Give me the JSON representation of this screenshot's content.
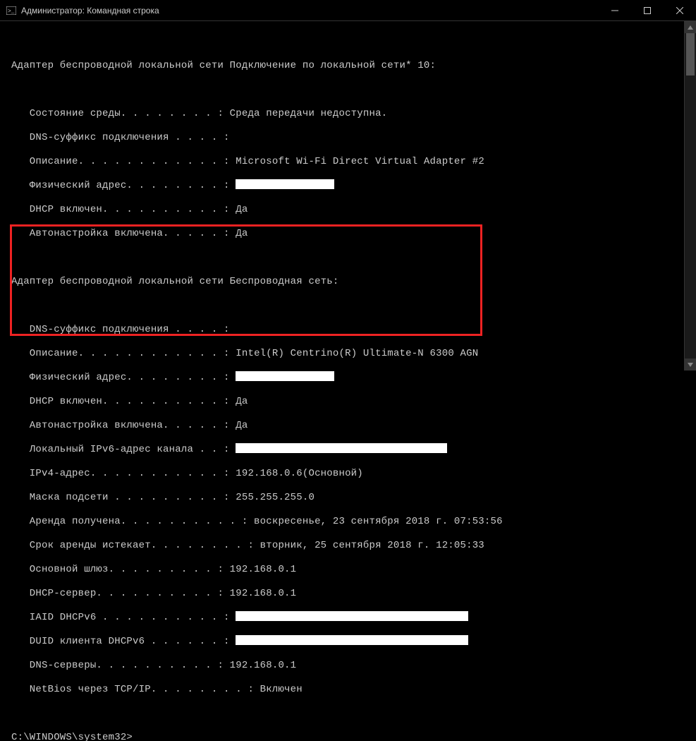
{
  "window": {
    "title": "Администратор: Командная строка"
  },
  "adapter1": {
    "header": "Адаптер беспроводной локальной сети Подключение по локальной сети* 10:",
    "mediaState": "   Состояние среды. . . . . . . . : Среда передачи недоступна.",
    "dnsSuffix": "   DNS-суффикс подключения . . . . :",
    "descLabel": "   Описание. . . . . . . . . . . . : ",
    "descValue": "Microsoft Wi-Fi Direct Virtual Adapter #2",
    "physLabel": "   Физический адрес. . . . . . . . : ",
    "dhcp": "   DHCP включен. . . . . . . . . . : Да",
    "autoconf": "   Автонастройка включена. . . . . : Да"
  },
  "adapter2": {
    "header": "Адаптер беспроводной локальной сети Беспроводная сеть:",
    "dnsSuffix": "   DNS-суффикс подключения . . . . :",
    "descLabel": "   Описание. . . . . . . . . . . . : ",
    "descValue": "Intel(R) Centrino(R) Ultimate-N 6300 AGN",
    "physLabel": "   Физический адрес. . . . . . . . : ",
    "dhcp": "   DHCP включен. . . . . . . . . . : Да",
    "autoconf": "   Автонастройка включена. . . . . : Да",
    "ipv6Label": "   Локальный IPv6-адрес канала . . : ",
    "ipv4": "   IPv4-адрес. . . . . . . . . . . : 192.168.0.6(Основной)",
    "mask": "   Маска подсети . . . . . . . . . : 255.255.255.0",
    "leaseObt": "   Аренда получена. . . . . . . . . . : воскресенье, 23 сентября 2018 г. 07:53:56",
    "leaseExp": "   Срок аренды истекает. . . . . . . . : вторник, 25 сентября 2018 г. 12:05:33",
    "gateway": "   Основной шлюз. . . . . . . . . : 192.168.0.1",
    "dhcpServer": "   DHCP-сервер. . . . . . . . . . : 192.168.0.1",
    "iaidLabel": "   IAID DHCPv6 . . . . . . . . . . : ",
    "duidLabel": "   DUID клиента DHCPv6 . . . . . . : ",
    "dns": "   DNS-серверы. . . . . . . . . . : 192.168.0.1",
    "netbios": "   NetBios через TCP/IP. . . . . . . . : Включен"
  },
  "prompt": "C:\\WINDOWS\\system32>"
}
